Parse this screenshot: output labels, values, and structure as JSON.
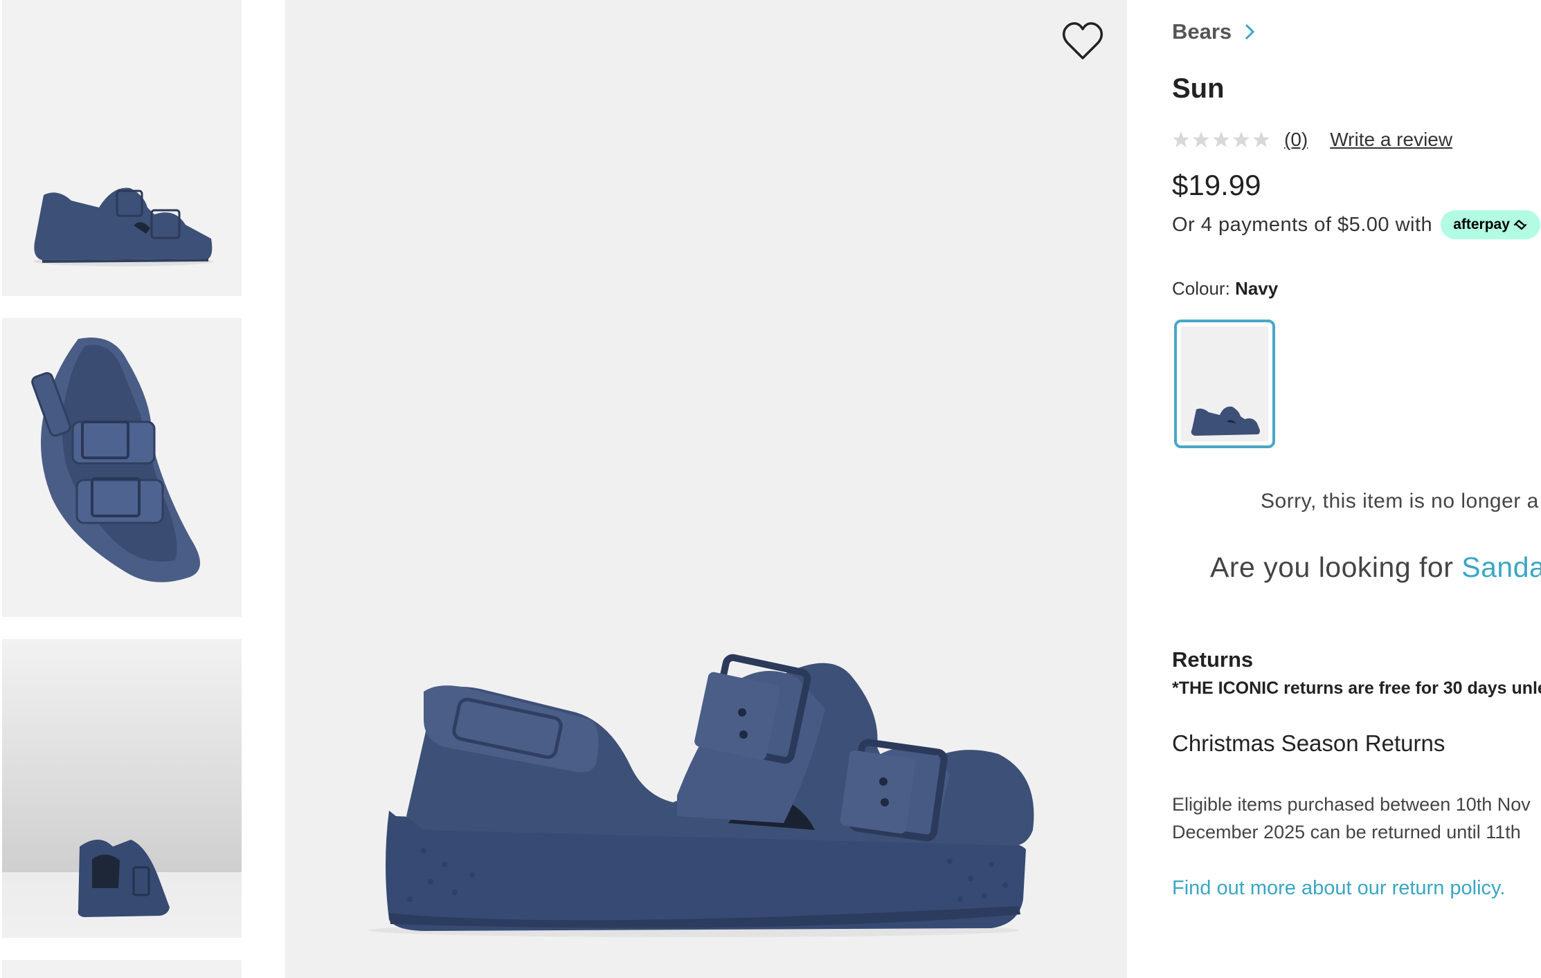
{
  "gallery": {
    "thumbnails": [
      "side-view",
      "top-angle-view",
      "rear-view",
      "partial-next"
    ]
  },
  "wishlist": {
    "icon": "heart-outline-icon"
  },
  "product": {
    "breadcrumb": "Bears",
    "title": "Sun",
    "rating": {
      "value": 0,
      "max": 5,
      "count_label": "(0)",
      "write_review": "Write a review"
    },
    "price": "$19.99",
    "afterpay": {
      "text": "Or 4 payments of $5.00 with",
      "badge": "afterpay"
    },
    "colour": {
      "label": "Colour:",
      "value": "Navy"
    }
  },
  "availability": {
    "sorry": "Sorry, this item is no longer a",
    "looking_prefix": "Are you looking for ",
    "looking_link": "Sanda"
  },
  "returns": {
    "heading": "Returns",
    "policy_line": "*THE ICONIC returns are free for 30 days unle",
    "christmas_heading": "Christmas Season Returns",
    "eligible_line1": "Eligible items purchased between 10th Nov",
    "eligible_line2": "December 2025 can be returned until 11th",
    "link": "Find out more about our return policy."
  },
  "colors": {
    "accent": "#3aa6c3",
    "sandal_navy": "#3d5077",
    "afterpay_mint": "#b2fce4",
    "swatch_border": "#49a7c6",
    "star_empty": "#d8d8d8"
  }
}
